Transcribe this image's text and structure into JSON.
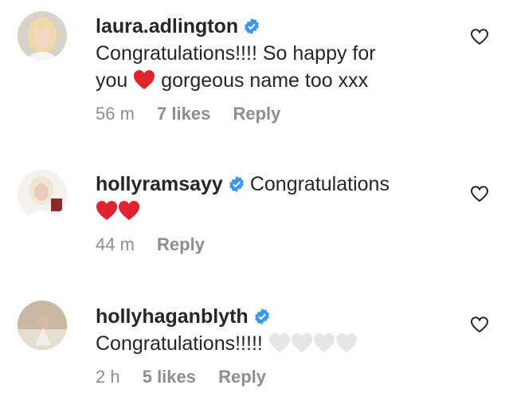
{
  "comments": [
    {
      "username": "laura.adlington",
      "verified": true,
      "text_line1": "Congratulations!!!! So happy for",
      "text_before_emoji": "you",
      "emoji": "red-heart",
      "text_after_emoji": "gorgeous name too xxx",
      "time": "56 m",
      "likes": "7 likes",
      "reply": "Reply"
    },
    {
      "username": "hollyramsayy",
      "verified": true,
      "text": "Congratulations",
      "emoji_line": "red-heart x2",
      "time": "44 m",
      "reply": "Reply"
    },
    {
      "username": "hollyhaganblyth",
      "verified": true,
      "text": "Congratulations!!!!!",
      "emoji_line": "white-heart x4",
      "time": "2 h",
      "likes": "5 likes",
      "reply": "Reply"
    }
  ],
  "colors": {
    "text": "#262626",
    "meta": "#8e8e8e",
    "verified_blue": "#3897f0",
    "red_heart": "#e0242f"
  }
}
